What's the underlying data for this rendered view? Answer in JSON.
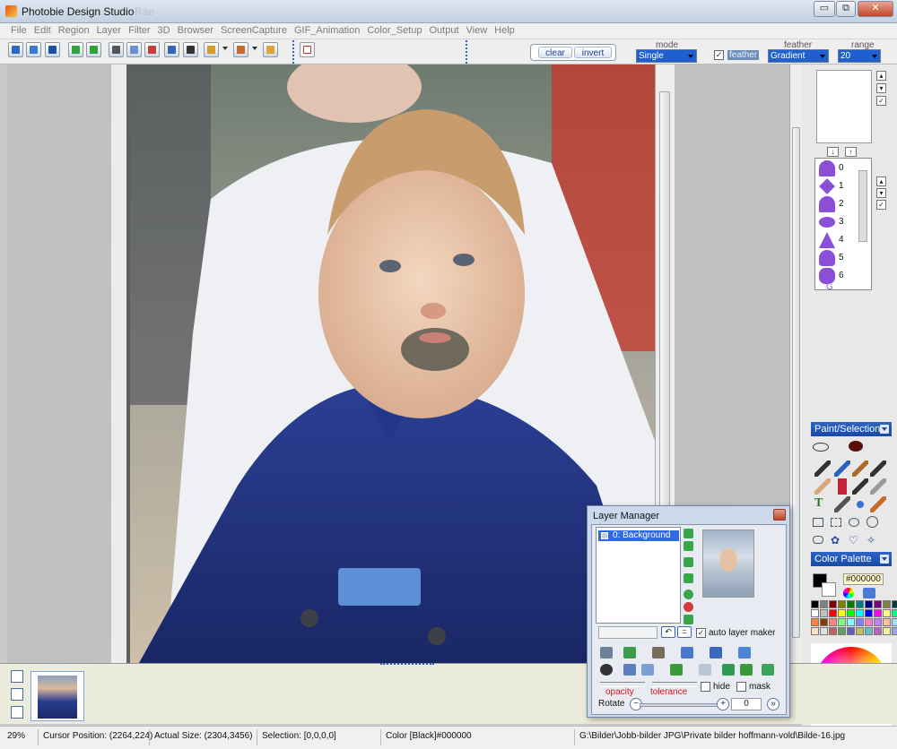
{
  "window": {
    "title": "Photobie Design Studio",
    "faded_title": "Rae",
    "buttons": {
      "minimize": "▭",
      "restore": "⧉",
      "close": "✕"
    }
  },
  "menu": [
    "File",
    "Edit",
    "Region",
    "Layer",
    "Filter",
    "3D",
    "Browser",
    "ScreenCapture",
    "GIF_Animation",
    "Color_Setup",
    "Output",
    "View",
    "Help"
  ],
  "toolbar": {
    "clear_label": "clear",
    "invert_label": "invert",
    "mode_label": "mode",
    "mode_value": "Single",
    "feather_check_label": "feather",
    "feather_label": "feather",
    "feather_value": "Gradient",
    "range_label": "range",
    "range_value": "20"
  },
  "shape_list": [
    "0",
    "1",
    "2",
    "3",
    "4",
    "5",
    "6",
    "G"
  ],
  "panels": {
    "paint_selection": "Paint/Selection",
    "color_palette": "Color Palette",
    "current_color_hex": "#000000"
  },
  "palette_colors": [
    "#000000",
    "#808080",
    "#800000",
    "#808000",
    "#008000",
    "#008080",
    "#000080",
    "#800080",
    "#808040",
    "#004040",
    "#ffffff",
    "#c0c0c0",
    "#ff0000",
    "#ffff00",
    "#00ff00",
    "#00ffff",
    "#0000ff",
    "#ff00ff",
    "#ffff80",
    "#00ff80",
    "#ff8040",
    "#804000",
    "#ff8080",
    "#80ff80",
    "#80ffff",
    "#8080ff",
    "#ff80c0",
    "#c080ff",
    "#ffc0a0",
    "#a0e0ff",
    "#ffe0c0",
    "#e0e0e0",
    "#c06060",
    "#60a060",
    "#6060c0",
    "#c0c060",
    "#60c0c0",
    "#c060c0",
    "#f0f0a0",
    "#a0a0f0"
  ],
  "layer_manager": {
    "title": "Layer Manager",
    "layer_name": "0: Background",
    "auto_layer_label": "auto layer maker",
    "opacity_label": "opacity",
    "tolerance_label": "tolerance",
    "hide_label": "hide",
    "mask_label": "mask",
    "rotate_label": "Rotate",
    "rotate_value": "0",
    "undo_btn": "↶",
    "eq_btn": "="
  },
  "status": {
    "zoom": "29%",
    "cursor": "Cursor Position: (2264,224)",
    "actual_size": "Actual Size: (2304,3456)",
    "selection": "Selection: [0,0,0,0]",
    "color": "Color [Black]#000000",
    "path": "G:\\Bilder\\Jobb-bilder JPG\\Private bilder hoffmann-vold\\Bilde-16.jpg"
  },
  "colors": {
    "accent": "#1f5fd0",
    "shape_purple": "#8a4fd6",
    "panel_header": "#2f64c6"
  }
}
